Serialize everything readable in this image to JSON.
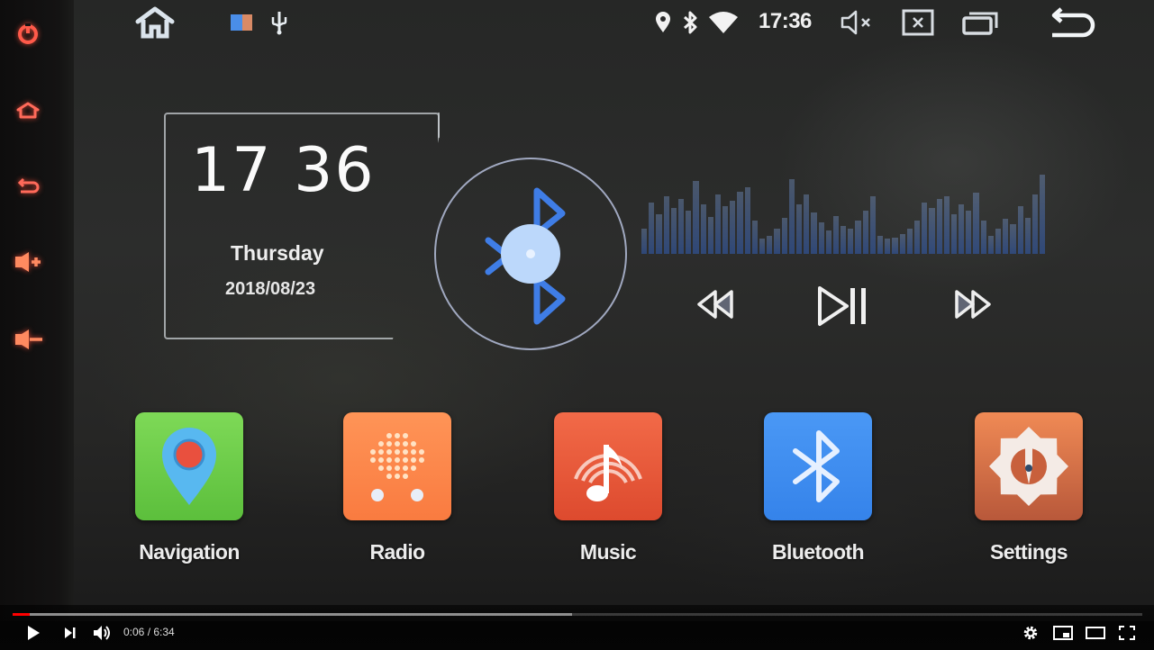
{
  "hardware_buttons": [
    {
      "name": "power",
      "icon": "power-icon"
    },
    {
      "name": "home",
      "icon": "home-icon"
    },
    {
      "name": "back",
      "icon": "back-icon"
    },
    {
      "name": "volume-up",
      "icon": "volume-up-icon"
    },
    {
      "name": "volume-down",
      "icon": "volume-down-icon"
    }
  ],
  "status_bar": {
    "home_icon": "home-icon",
    "notification_icons": [
      "gallery-icon",
      "usb-icon"
    ],
    "system_icons": [
      "location-icon",
      "bluetooth-icon",
      "wifi-icon"
    ],
    "time": "17:36",
    "actions": [
      "mute-icon",
      "close-app-icon",
      "recent-apps-icon",
      "back-icon"
    ]
  },
  "clock_widget": {
    "time": "17 36",
    "day": "Thursday",
    "date": "2018/08/23"
  },
  "bluetooth_widget": {
    "icon": "bluetooth-disc-icon"
  },
  "media_controls": {
    "prev": "rewind-icon",
    "play_pause": "play-pause-icon",
    "next": "fast-forward-icon"
  },
  "apps": [
    {
      "label": "Navigation",
      "icon": "map-pin-icon",
      "color": "#6cc648"
    },
    {
      "label": "Radio",
      "icon": "radio-icon",
      "color": "#ff8a4c"
    },
    {
      "label": "Music",
      "icon": "music-note-icon",
      "color": "#ea5a3c"
    },
    {
      "label": "Bluetooth",
      "icon": "bluetooth-icon",
      "color": "#3d8ff0"
    },
    {
      "label": "Settings",
      "icon": "settings-gear-icon",
      "color": "#e07a48"
    }
  ],
  "video_player": {
    "current_time": "0:06",
    "duration": "6:34",
    "time_display": "0:06 / 6:34",
    "played_fraction": 0.015,
    "buffered_fraction": 0.495,
    "accent_color": "#ff0000"
  }
}
